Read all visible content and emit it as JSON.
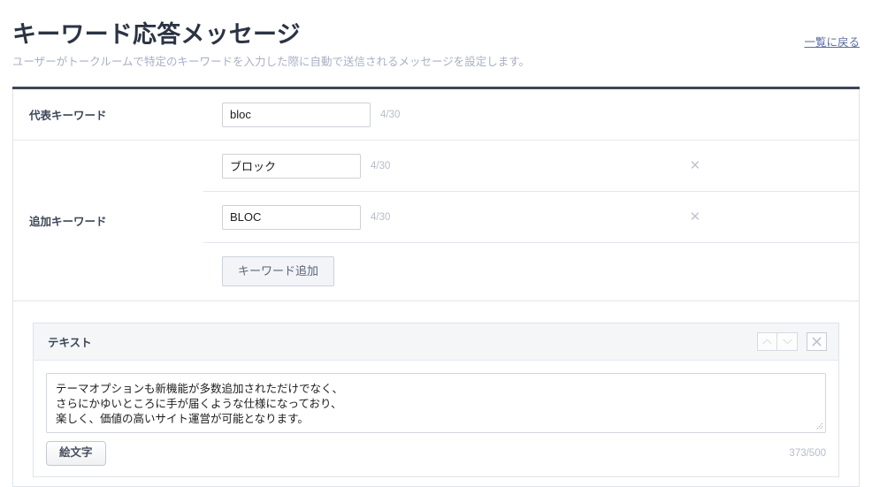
{
  "header": {
    "title": "キーワード応答メッセージ",
    "subtitle": "ユーザーがトークルームで特定のキーワードを入力した際に自動で送信されるメッセージを設定します。",
    "back_link": "一覧に戻る"
  },
  "form": {
    "main_keyword": {
      "label": "代表キーワード",
      "value": "bloc",
      "counter": "4/30",
      "placeholder": ""
    },
    "additional_keywords": {
      "label": "追加キーワード",
      "items": [
        {
          "value": "ブロック",
          "counter": "4/30",
          "delete_icon": "close-icon"
        },
        {
          "value": "BLOC",
          "counter": "4/30",
          "delete_icon": "close-icon"
        }
      ],
      "add_button": "キーワード追加"
    }
  },
  "message_block": {
    "title": "テキスト",
    "controls": [
      {
        "name": "move-up",
        "icon": "chevron-up-icon"
      },
      {
        "name": "move-down",
        "icon": "chevron-down-icon"
      },
      {
        "name": "remove-block",
        "icon": "close-icon"
      }
    ],
    "textarea": {
      "value": "テーマオプションも新機能が多数追加されただけでなく、\nさらにかゆいところに手が届くような仕様になっており、\n楽しく、価値の高いサイト運営が可能となります。",
      "placeholder": ""
    },
    "emoji_button": "絵文字",
    "char_count": "373/500"
  },
  "colors": {
    "title": "#2b3443",
    "subtitle": "#a8b0c4",
    "link": "#5b6b9e",
    "table_top_border": "#3d4759",
    "border": "#dfe3ea",
    "counter": "#b6bcc9",
    "panel_head_bg": "#f4f6f8"
  }
}
